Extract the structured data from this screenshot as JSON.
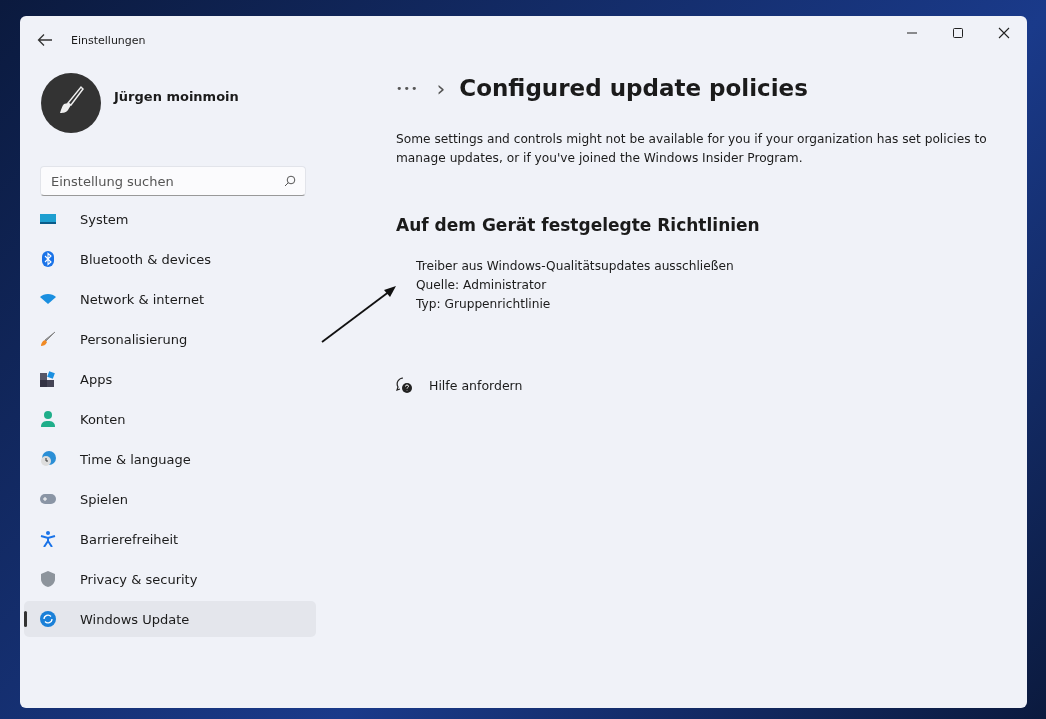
{
  "window": {
    "title": "Einstellungen"
  },
  "user": {
    "name": "Jürgen moinmoin"
  },
  "search": {
    "placeholder": "Einstellung suchen"
  },
  "sidebar": {
    "items": [
      {
        "label": "System",
        "selected": false
      },
      {
        "label": "Bluetooth & devices",
        "selected": false
      },
      {
        "label": "Network & internet",
        "selected": false
      },
      {
        "label": "Personalisierung",
        "selected": false
      },
      {
        "label": "Apps",
        "selected": false
      },
      {
        "label": "Konten",
        "selected": false
      },
      {
        "label": "Time & language",
        "selected": false
      },
      {
        "label": "Spielen",
        "selected": false
      },
      {
        "label": "Barrierefreiheit",
        "selected": false
      },
      {
        "label": "Privacy & security",
        "selected": false
      },
      {
        "label": "Windows Update",
        "selected": true
      }
    ]
  },
  "breadcrumb": {
    "ellipsis": "•••",
    "separator": "›",
    "title": "Configured update policies"
  },
  "description": "Some settings and controls might not be available for you if your organization has set policies to manage updates, or if you've joined the Windows Insider Program.",
  "section": {
    "heading": "Auf dem Gerät festgelegte Richtlinien",
    "policies": [
      {
        "name": "Treiber aus Windows-Qualitätsupdates ausschließen",
        "source": "Quelle: Administrator",
        "type": "Typ: Gruppenrichtlinie"
      }
    ]
  },
  "help_link": "Hilfe anfordern"
}
